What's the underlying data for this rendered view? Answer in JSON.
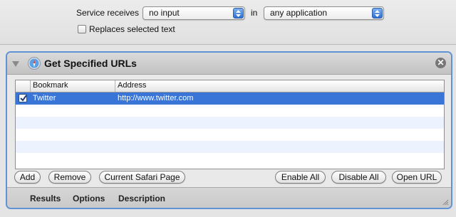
{
  "service": {
    "receives_label": "Service receives",
    "input_value": "no input",
    "in_label": "in",
    "app_value": "any application",
    "replaces_label": "Replaces selected text",
    "replaces_checked": false
  },
  "action": {
    "title": "Get Specified URLs",
    "close_glyph": "✕",
    "icon": "safari-compass-icon",
    "table": {
      "columns": [
        "Bookmark",
        "Address"
      ],
      "rows": [
        {
          "checked": true,
          "bookmark": "Twitter",
          "address": "http://www.twitter.com",
          "selected": true
        }
      ]
    },
    "buttons": {
      "add": "Add",
      "remove": "Remove",
      "current_safari": "Current Safari Page",
      "enable_all": "Enable All",
      "disable_all": "Disable All",
      "open_url": "Open URL"
    },
    "footer_tabs": [
      "Results",
      "Options",
      "Description"
    ]
  },
  "colors": {
    "accent": "#5f93d6",
    "selection": "#3875d7",
    "row_alt": "#edf3fe"
  }
}
